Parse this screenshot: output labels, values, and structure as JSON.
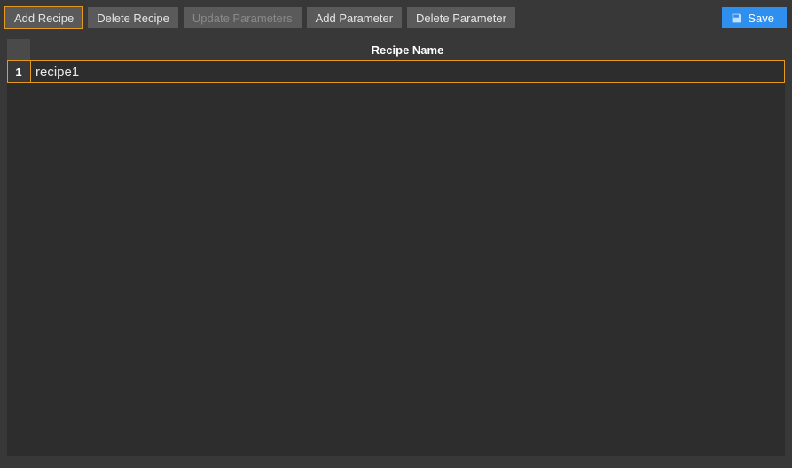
{
  "toolbar": {
    "add_recipe": "Add Recipe",
    "delete_recipe": "Delete Recipe",
    "update_parameters": "Update Parameters",
    "add_parameter": "Add Parameter",
    "delete_parameter": "Delete Parameter",
    "save": "Save"
  },
  "table": {
    "header": "Recipe Name",
    "rows": [
      {
        "num": "1",
        "name": "recipe1"
      }
    ]
  },
  "colors": {
    "accent": "#e59a1f",
    "primary": "#2f8fef"
  }
}
